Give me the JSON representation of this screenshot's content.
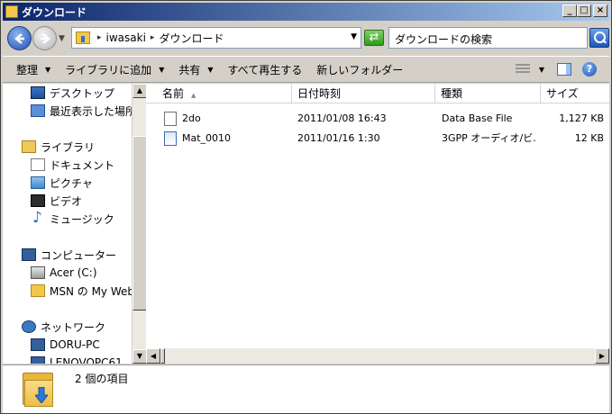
{
  "window": {
    "title": "ダウンロード",
    "buttons": {
      "minimize": "_",
      "maximize": "□",
      "close": "×"
    }
  },
  "address": {
    "breadcrumbs": [
      "iwasaki",
      "ダウンロード"
    ],
    "search_placeholder": "ダウンロードの検索"
  },
  "toolbar": {
    "items": [
      "整理",
      "ライブラリに追加",
      "共有",
      "すべて再生する",
      "新しいフォルダー"
    ]
  },
  "nav": {
    "items": [
      {
        "label": "デスクトップ",
        "icon": "desktop-icon"
      },
      {
        "label": "最近表示した場所",
        "icon": "recent-places-icon"
      },
      {
        "label": "ライブラリ",
        "icon": "library-icon"
      },
      {
        "label": "ドキュメント",
        "icon": "documents-icon"
      },
      {
        "label": "ピクチャ",
        "icon": "pictures-icon"
      },
      {
        "label": "ビデオ",
        "icon": "video-icon"
      },
      {
        "label": "ミュージック",
        "icon": "music-icon"
      },
      {
        "label": "コンピューター",
        "icon": "computer-icon"
      },
      {
        "label": "Acer (C:)",
        "icon": "drive-icon"
      },
      {
        "label": "MSN の My Web サ",
        "icon": "folder-icon"
      },
      {
        "label": "ネットワーク",
        "icon": "network-icon"
      },
      {
        "label": "DORU-PC",
        "icon": "pc-icon"
      },
      {
        "label": "LENOVOPC61",
        "icon": "pc-icon"
      }
    ]
  },
  "files": {
    "columns": [
      "名前",
      "日付時刻",
      "種類",
      "サイズ"
    ],
    "rows": [
      {
        "name": "2do",
        "date": "2011/01/08 16:43",
        "type": "Data Base File",
        "size": "1,127 KB",
        "icon": "database-file-icon"
      },
      {
        "name": "Mat_0010",
        "date": "2011/01/16 1:30",
        "type": "3GPP オーディオ/ビ...",
        "size": "12 KB",
        "icon": "media-file-icon"
      }
    ]
  },
  "details": {
    "count_text": "2 個の項目"
  },
  "colors": {
    "title_start": "#0a246a",
    "title_end": "#a6caf0",
    "face": "#d4d0c8"
  }
}
